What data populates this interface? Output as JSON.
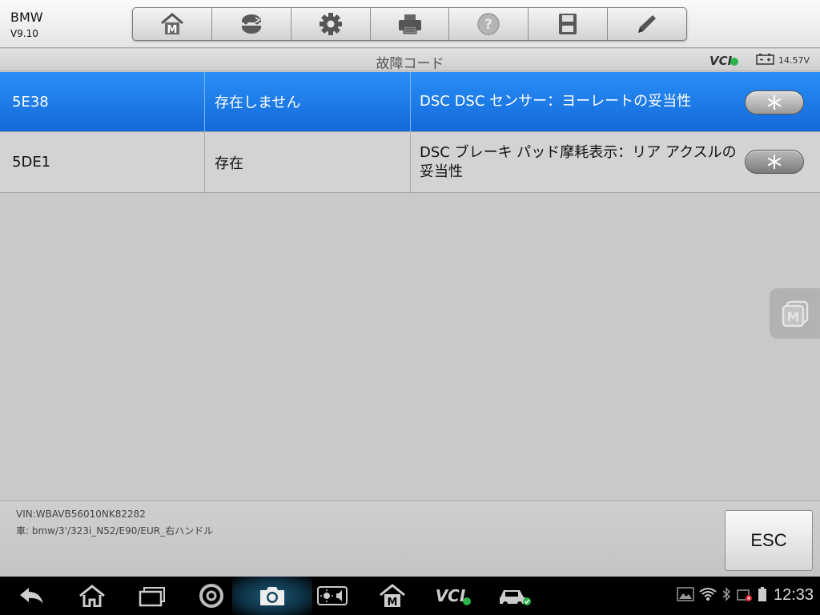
{
  "app": {
    "brand": "BMW",
    "version": "V9.10"
  },
  "toolbar": {
    "buttons": [
      "home-m-icon",
      "vehicle-swap-icon",
      "settings-gear-icon",
      "printer-icon",
      "help-icon",
      "save-icon",
      "edit-pencil-icon"
    ]
  },
  "header": {
    "title": "故障コード",
    "vci_label": "VCI",
    "voltage": "14.57V"
  },
  "dtc_rows": [
    {
      "code": "5E38",
      "status": "存在しません",
      "description": "DSC DSC センサー：ヨーレートの妥当性",
      "selected": true
    },
    {
      "code": "5DE1",
      "status": "存在",
      "description": "DSC ブレーキ パッド摩耗表示：リア アクスルの妥当性",
      "selected": false
    }
  ],
  "vehicle_info": {
    "vin": "VIN:WBAVB56010NK82282",
    "car": "車: bmw/3'/323i_N52/E90/EUR_右ハンドル"
  },
  "actions": {
    "esc_label": "ESC"
  },
  "system_bar": {
    "vci_label": "VCI",
    "clock": "12:33"
  },
  "colors": {
    "selected_row": "#1a78e8",
    "row_bg": "#d3d3d3",
    "page_bg": "#c9c9c9",
    "status_ok": "#2cb34a"
  }
}
